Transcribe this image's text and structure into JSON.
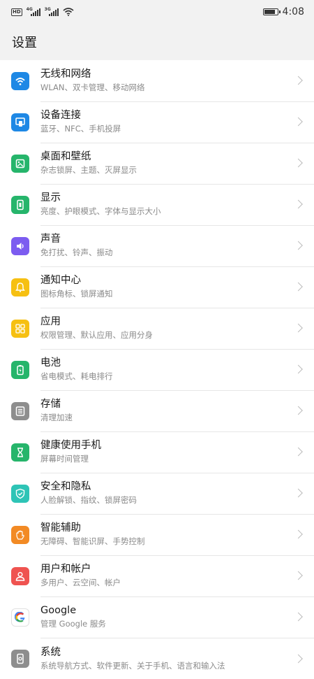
{
  "status_bar": {
    "hd_label": "HD",
    "sim1_label": "4G",
    "sim2_label": "3G",
    "time": "4:08"
  },
  "header": {
    "title": "设置"
  },
  "colors": {
    "wifi": "#1e88e5",
    "device": "#1e88e5",
    "desktop": "#26b56b",
    "display": "#26b56b",
    "sound": "#7c5cf0",
    "notify": "#f6c012",
    "apps": "#f6c012",
    "battery": "#26b56b",
    "storage": "#8e8e8e",
    "health": "#26b56b",
    "security": "#2ec4b6",
    "assist": "#f28a24",
    "users": "#ef5350",
    "google": "#ffffff",
    "system": "#8e8e8e"
  },
  "settings": [
    {
      "key": "wifi",
      "icon": "wifi-icon",
      "title": "无线和网络",
      "subtitle": "WLAN、双卡管理、移动网络"
    },
    {
      "key": "device",
      "icon": "device-connection-icon",
      "title": "设备连接",
      "subtitle": "蓝牙、NFC、手机投屏"
    },
    {
      "key": "desktop",
      "icon": "wallpaper-icon",
      "title": "桌面和壁纸",
      "subtitle": "杂志锁屏、主题、灭屏显示"
    },
    {
      "key": "display",
      "icon": "display-icon",
      "title": "显示",
      "subtitle": "亮度、护眼模式、字体与显示大小"
    },
    {
      "key": "sound",
      "icon": "sound-icon",
      "title": "声音",
      "subtitle": "免打扰、铃声、振动"
    },
    {
      "key": "notify",
      "icon": "bell-icon",
      "title": "通知中心",
      "subtitle": "图标角标、锁屏通知"
    },
    {
      "key": "apps",
      "icon": "apps-grid-icon",
      "title": "应用",
      "subtitle": "权限管理、默认应用、应用分身"
    },
    {
      "key": "battery",
      "icon": "battery-icon",
      "title": "电池",
      "subtitle": "省电模式、耗电排行"
    },
    {
      "key": "storage",
      "icon": "storage-icon",
      "title": "存储",
      "subtitle": "清理加速"
    },
    {
      "key": "health",
      "icon": "hourglass-icon",
      "title": "健康使用手机",
      "subtitle": "屏幕时间管理"
    },
    {
      "key": "security",
      "icon": "shield-icon",
      "title": "安全和隐私",
      "subtitle": "人脸解锁、指纹、锁屏密码"
    },
    {
      "key": "assist",
      "icon": "hand-icon",
      "title": "智能辅助",
      "subtitle": "无障碍、智能识屏、手势控制"
    },
    {
      "key": "users",
      "icon": "user-icon",
      "title": "用户和帐户",
      "subtitle": "多用户、云空间、帐户"
    },
    {
      "key": "google",
      "icon": "google-icon",
      "title": "Google",
      "subtitle": "管理 Google 服务"
    },
    {
      "key": "system",
      "icon": "phone-system-icon",
      "title": "系统",
      "subtitle": "系统导航方式、软件更新、关于手机、语言和输入法"
    }
  ]
}
